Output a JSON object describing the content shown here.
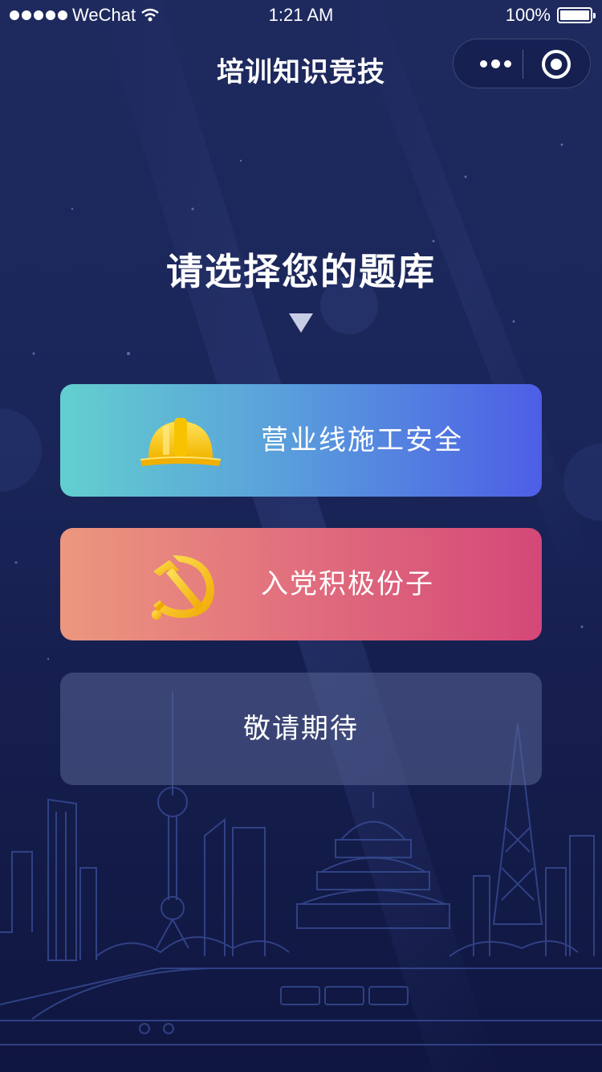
{
  "statusbar": {
    "carrier": "WeChat",
    "time": "1:21 AM",
    "battery": "100%"
  },
  "navbar": {
    "title": "培训知识竞技"
  },
  "main": {
    "heading": "请选择您的题库",
    "options": [
      {
        "label": "营业线施工安全",
        "icon": "hard-hat-icon"
      },
      {
        "label": "入党积极份子",
        "icon": "hammer-sickle-icon"
      },
      {
        "label": "敬请期待",
        "icon": ""
      }
    ]
  },
  "colors": {
    "background": "#1a2559",
    "card1_start": "#63cfcf",
    "card1_end": "#4d5ee6",
    "card2_start": "#ec977e",
    "card2_end": "#d44878",
    "card3": "#4a5483"
  }
}
